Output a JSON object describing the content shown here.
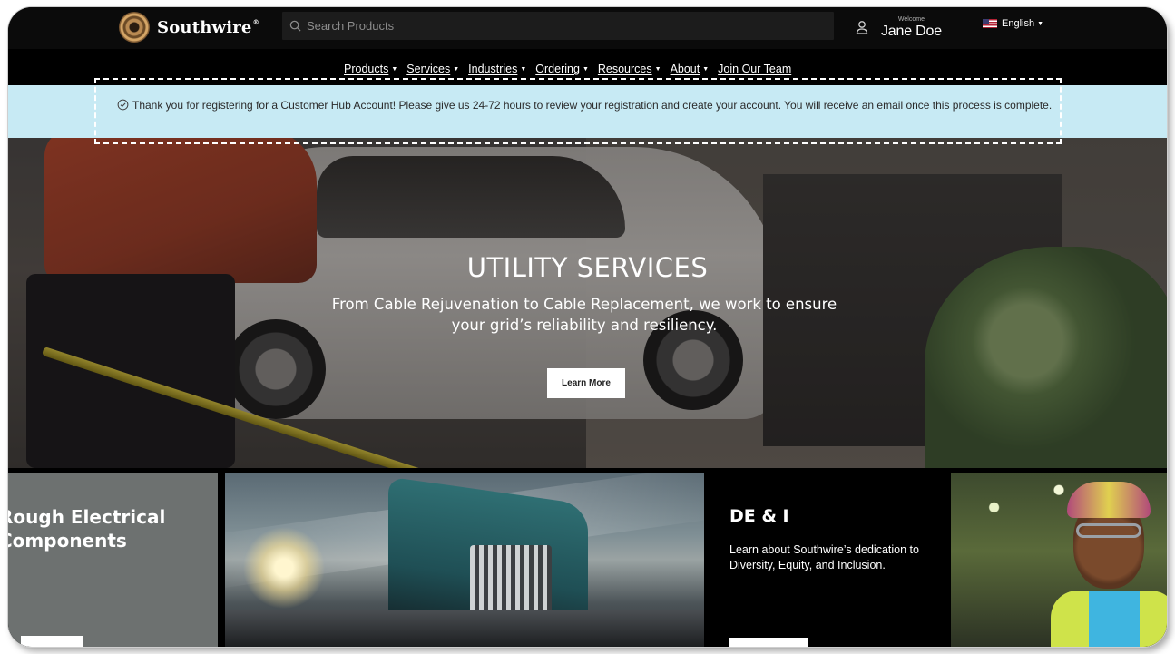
{
  "header": {
    "logo_text": "Southwire",
    "logo_reg": "®",
    "search_placeholder": "Search Products",
    "welcome_label": "Welcome",
    "user_name": "Jane Doe",
    "language": "English"
  },
  "nav": {
    "items": [
      {
        "label": "Products",
        "dropdown": true
      },
      {
        "label": "Services",
        "dropdown": true
      },
      {
        "label": "Industries",
        "dropdown": true
      },
      {
        "label": "Ordering",
        "dropdown": true
      },
      {
        "label": "Resources",
        "dropdown": true
      },
      {
        "label": "About",
        "dropdown": true
      },
      {
        "label": "Join Our Team",
        "dropdown": false
      }
    ]
  },
  "banner": {
    "message": "Thank you for registering for a Customer Hub Account! Please give us 24-72 hours to review your registration and create your account. You will receive an email once this process is complete.",
    "accent_color": "#c7eaf4"
  },
  "hero": {
    "title": "UTILITY SERVICES",
    "subtitle": "From Cable Rejuvenation to Cable Replacement, we work to ensure your grid’s reliability and resiliency.",
    "button_label": "Learn More"
  },
  "cards": {
    "card1_title_line1": "Rough Electrical",
    "card1_title_line2": "Components",
    "dei_title": "DE & I",
    "dei_text": "Learn about Southwire’s dedication to Diversity, Equity, and Inclusion."
  },
  "icons": {
    "search": "search-icon",
    "user": "user-icon",
    "check": "check-circle-icon",
    "flag": "us-flag-icon",
    "caret": "caret-down-icon"
  }
}
